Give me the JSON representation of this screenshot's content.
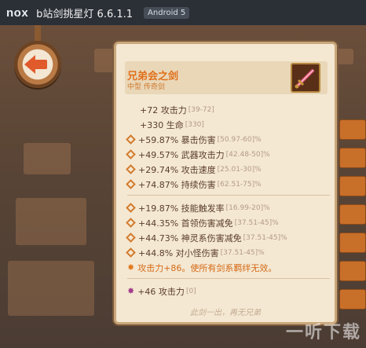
{
  "window": {
    "logo": "nox",
    "title": "b站剑挑星灯 6.6.1.1",
    "android": "Android 5"
  },
  "item": {
    "name": "兄弟会之剑",
    "type": "中型 传奇剑",
    "icon": "sword-icon"
  },
  "base_stats": [
    {
      "text": "+72 攻击力",
      "range": "[39-72]"
    },
    {
      "text": "+330 生命",
      "range": "[330]"
    }
  ],
  "affixes": [
    {
      "text": "+59.87% 暴击伤害",
      "range": "[50.97-60]%"
    },
    {
      "text": "+49.57% 武器攻击力",
      "range": "[42.48-50]%"
    },
    {
      "text": "+29.74% 攻击速度",
      "range": "[25.01-30]%"
    },
    {
      "text": "+74.87% 持续伤害",
      "range": "[62.51-75]%"
    }
  ],
  "affixes2": [
    {
      "text": "+19.87% 技能触发率",
      "range": "[16.99-20]%"
    },
    {
      "text": "+44.35% 首领伤害减免",
      "range": "[37.51-45]%"
    },
    {
      "text": "+44.73% 神灵系伤害减免",
      "range": "[37.51-45]%"
    },
    {
      "text": "+44.8% 对小怪伤害",
      "range": "[37.51-45]%"
    }
  ],
  "special_effect": "攻击力+86。使所有剑系羁绊无效。",
  "enchant": {
    "text": "+46 攻击力",
    "range": "[0]"
  },
  "quote": "此剑一出，再无兄弟",
  "watermark": "一听下载",
  "colors": {
    "accent": "#e0701a",
    "panel": "#f4e8d3",
    "stat_text": "#5a3d2a"
  }
}
